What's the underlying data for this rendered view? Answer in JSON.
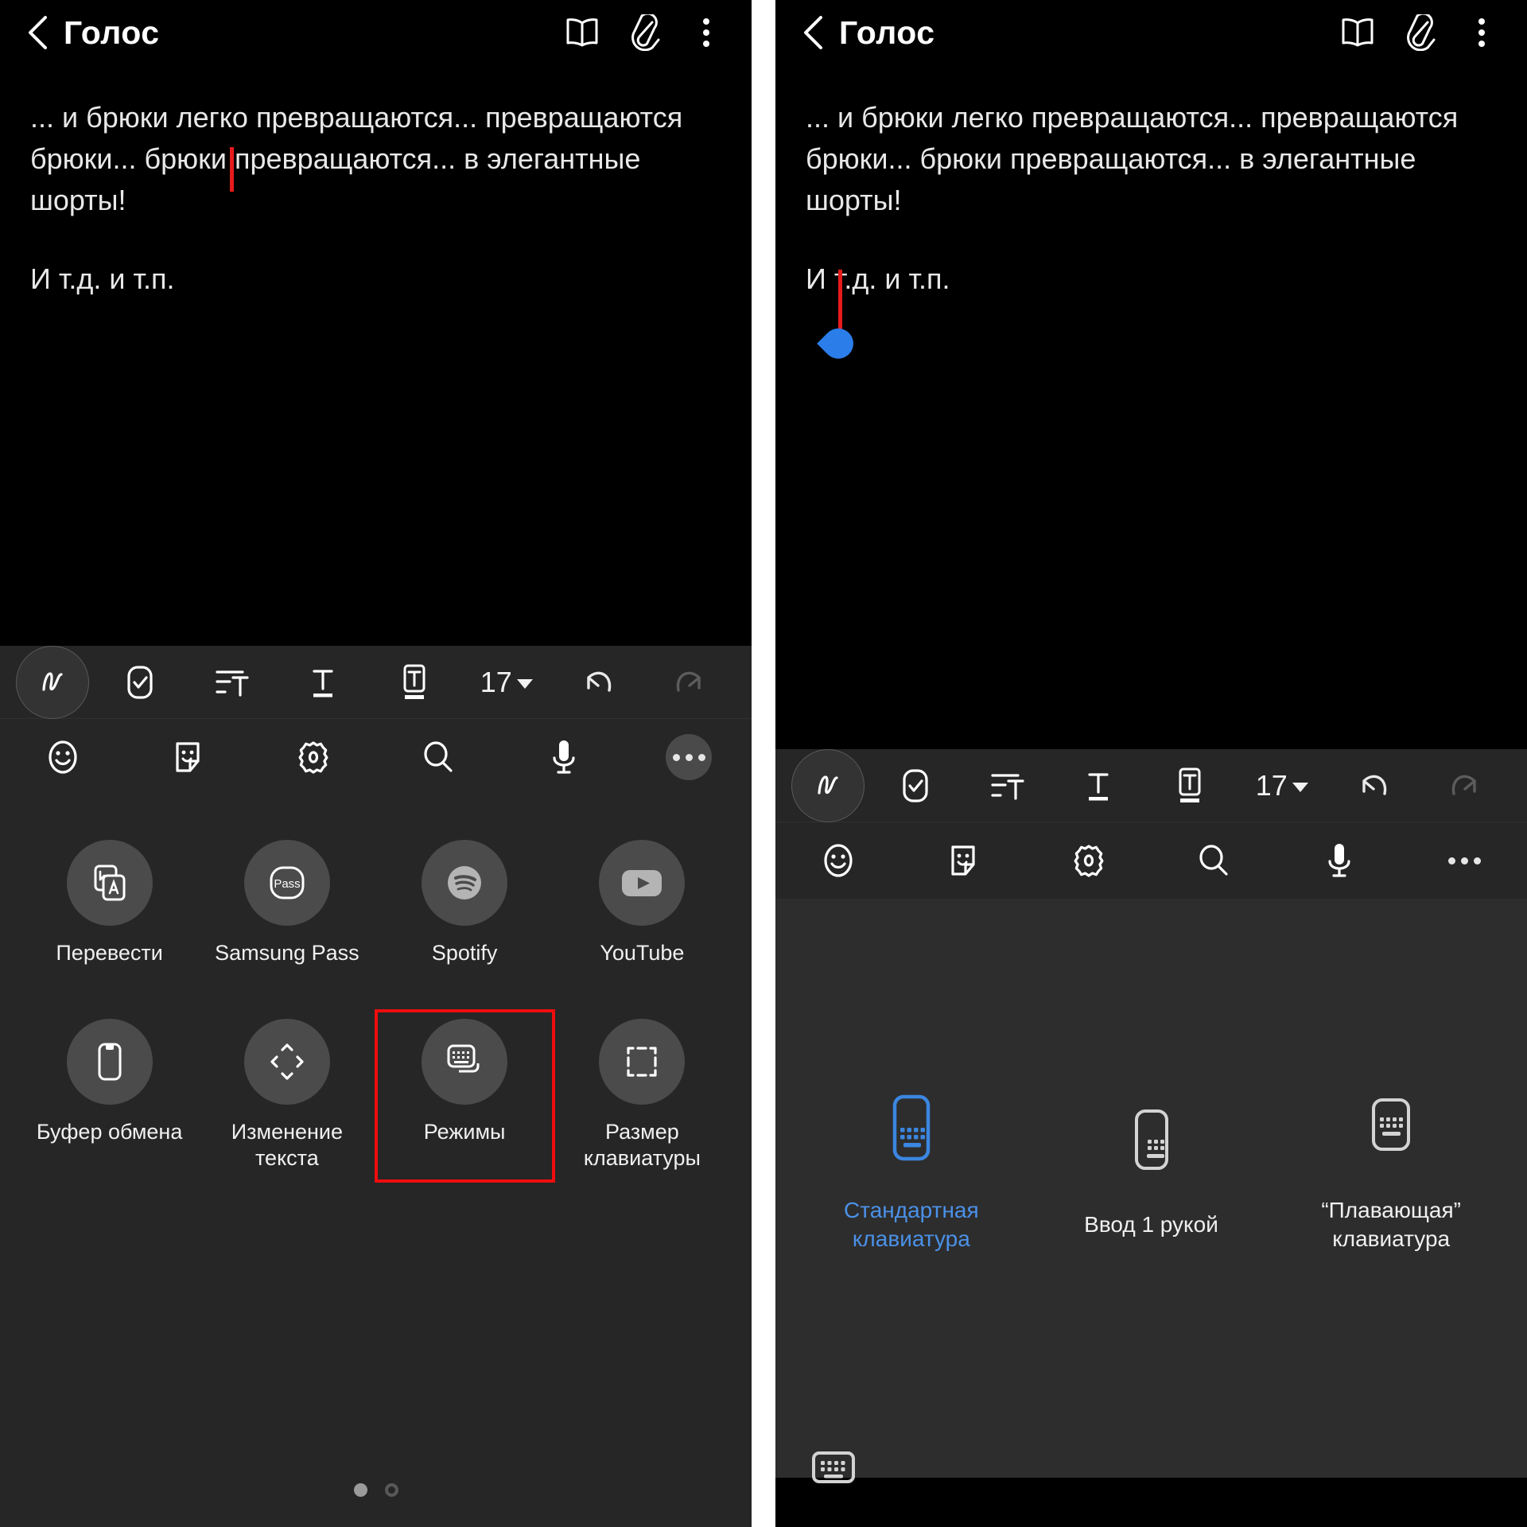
{
  "app": {
    "title": "Голос",
    "back_icon": "back-chevron-icon",
    "actions": [
      {
        "name": "book-icon",
        "label": "Режим чтения"
      },
      {
        "name": "paperclip-icon",
        "label": "Вложение"
      },
      {
        "name": "overflow-menu-icon",
        "label": "Ещё"
      }
    ]
  },
  "note": {
    "paragraph1": "... и брюки легко превращаются... превращаются брюки... брюки превращаются... в элегантные шорты!",
    "paragraph2": "И т.д. и т.п.",
    "annotation_color": "#e71b1b",
    "cursor_handle_color": "#2b7de9"
  },
  "format_toolbar": {
    "font_size": "17",
    "items": [
      {
        "name": "handwriting-pen-icon",
        "label": "Рукописный ввод"
      },
      {
        "name": "checklist-icon",
        "label": "Список задач"
      },
      {
        "name": "paragraph-format-icon",
        "label": "Формат абзаца"
      },
      {
        "name": "text-style-icon",
        "label": "Стиль текста"
      },
      {
        "name": "text-box-icon",
        "label": "Текстовый блок"
      },
      {
        "name": "font-size-selector",
        "label": "17"
      },
      {
        "name": "undo-icon",
        "label": "Отменить"
      },
      {
        "name": "redo-icon",
        "label": "Повторить"
      }
    ]
  },
  "keyboard_toolbar": {
    "items": [
      {
        "name": "emoji-icon",
        "label": "Эмодзи"
      },
      {
        "name": "sticker-icon",
        "label": "Стикеры"
      },
      {
        "name": "settings-gear-icon",
        "label": "Настройки"
      },
      {
        "name": "search-icon",
        "label": "Поиск"
      },
      {
        "name": "microphone-icon",
        "label": "Голосовой ввод"
      },
      {
        "name": "more-options-icon",
        "label": "Ещё"
      }
    ]
  },
  "left_panel": {
    "apps": [
      {
        "label": "Перевести",
        "icon": "translate-icon",
        "highlighted": false
      },
      {
        "label": "Samsung Pass",
        "icon": "samsung-pass-icon",
        "highlighted": false
      },
      {
        "label": "Spotify",
        "icon": "spotify-icon",
        "highlighted": false
      },
      {
        "label": "YouTube",
        "icon": "youtube-icon",
        "highlighted": false
      },
      {
        "label": "Буфер обмена",
        "icon": "clipboard-icon",
        "highlighted": false
      },
      {
        "label": "Изменение текста",
        "icon": "text-edit-cursor-icon",
        "highlighted": false
      },
      {
        "label": "Режимы",
        "icon": "keyboard-modes-icon",
        "highlighted": true
      },
      {
        "label": "Размер клавиатуры",
        "icon": "keyboard-size-icon",
        "highlighted": false
      }
    ],
    "page_dots": {
      "count": 2,
      "active_index": 0
    },
    "highlight_color": "#ef0d0d"
  },
  "right_panel": {
    "modes": [
      {
        "label": "Стандартная клавиатура",
        "icon": "standard-keyboard-icon",
        "selected": true
      },
      {
        "label": "Ввод 1 рукой",
        "icon": "one-handed-keyboard-icon",
        "selected": false
      },
      {
        "label": "“Плавающая” клавиатура",
        "icon": "floating-keyboard-icon",
        "selected": false
      }
    ],
    "selected_color": "#4b91e8",
    "keyboard_toggle_icon": "show-keyboard-icon"
  }
}
